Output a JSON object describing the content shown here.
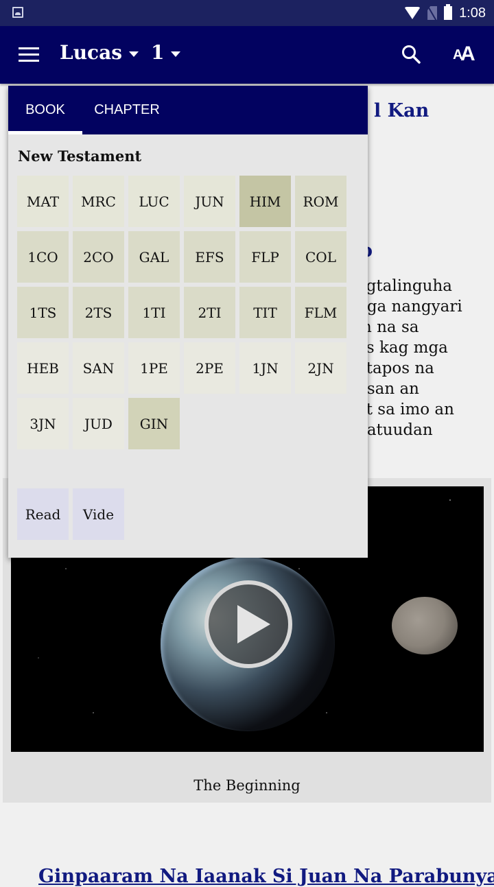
{
  "status_bar": {
    "time": "1:08",
    "icons": [
      "image-notification-icon",
      "wifi-icon",
      "no-sim-icon",
      "battery-icon"
    ]
  },
  "app_bar": {
    "book": "Lucas",
    "chapter": "1",
    "menu_icon": "hamburger-menu-icon",
    "search_icon": "search-icon",
    "font_size_icon": "font-size-icon",
    "font_size_glyph_small": "A",
    "font_size_glyph_big": "A",
    "color": "#020260"
  },
  "background_content": {
    "heading_1_fragment": "l Kan",
    "heading_2_fragment": "o",
    "paragraph_fragment": "agtalinguha\nnga nangyari\nm na sa\nos kag mga\natapos na\nusan an\nat sa imo an\nnatuudan",
    "video": {
      "caption": "The Beginning",
      "play_icon": "play-icon"
    },
    "heading_3": "Ginpaaram Na Iaanak Si Juan Na Parabunyag"
  },
  "picker": {
    "tabs": [
      {
        "label": "BOOK",
        "active": true
      },
      {
        "label": "CHAPTER",
        "active": false
      }
    ],
    "section_title": "New Testament",
    "books": [
      {
        "code": "MAT",
        "style": "t1"
      },
      {
        "code": "MRC",
        "style": "t1"
      },
      {
        "code": "LUC",
        "style": "t1"
      },
      {
        "code": "JUN",
        "style": "t1"
      },
      {
        "code": "HIM",
        "style": "sel"
      },
      {
        "code": "ROM",
        "style": "t2"
      },
      {
        "code": "1CO",
        "style": "t2"
      },
      {
        "code": "2CO",
        "style": "t2"
      },
      {
        "code": "GAL",
        "style": "t2"
      },
      {
        "code": "EFS",
        "style": "t2"
      },
      {
        "code": "FLP",
        "style": "t2"
      },
      {
        "code": "COL",
        "style": "t2"
      },
      {
        "code": "1TS",
        "style": "t2"
      },
      {
        "code": "2TS",
        "style": "t2"
      },
      {
        "code": "1TI",
        "style": "t2"
      },
      {
        "code": "2TI",
        "style": "t2"
      },
      {
        "code": "TIT",
        "style": "t2"
      },
      {
        "code": "FLM",
        "style": "t2"
      },
      {
        "code": "HEB",
        "style": "t3"
      },
      {
        "code": "SAN",
        "style": "t3"
      },
      {
        "code": "1PE",
        "style": "t3"
      },
      {
        "code": "2PE",
        "style": "t3"
      },
      {
        "code": "1JN",
        "style": "t3"
      },
      {
        "code": "2JN",
        "style": "t3"
      },
      {
        "code": "3JN",
        "style": "t3"
      },
      {
        "code": "JUD",
        "style": "t3"
      },
      {
        "code": "GIN",
        "style": "gin"
      }
    ],
    "modes": [
      {
        "label": "Read"
      },
      {
        "label": "Vide"
      }
    ]
  }
}
